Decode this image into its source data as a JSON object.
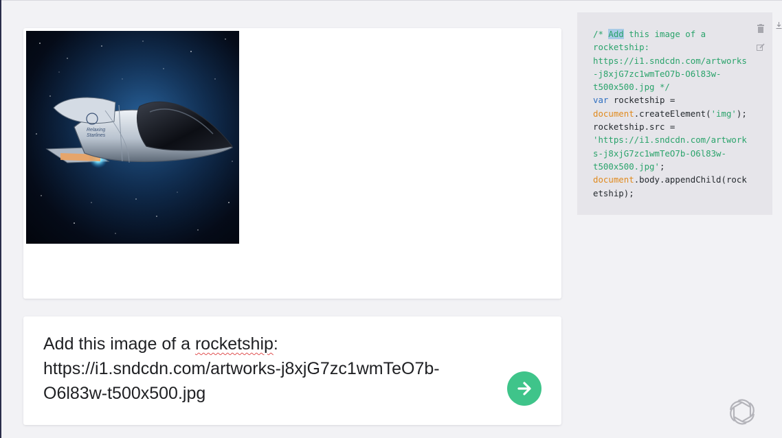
{
  "output": {
    "image_alt": "rocketship",
    "rocket_decal": [
      "Relaxing",
      "Starlines"
    ]
  },
  "prompt": {
    "line1_before": "Add this image of a ",
    "line1_word": "rocketship",
    "line1_after": ":",
    "line2": "https://i1.sndcdn.com/artworks-j8xjG7zc1wmTeO7b-",
    "line3": "O6l83w-t500x500.jpg"
  },
  "code": {
    "l1_a": "/* ",
    "l1_sel": "Add",
    "l1_b": " this image of a",
    "l2": "rocketship:",
    "l3": "https://i1.sndcdn.com/artworks",
    "l4": "-j8xjG7zc1wmTeO7b-O6l83w-",
    "l5": "t500x500.jpg */",
    "l6_kw": "var",
    "l6_rest": " rocketship =",
    "l7_obj": "document",
    "l7_mid": ".createElement(",
    "l7_str": "'img'",
    "l7_end": ");",
    "l8": "rocketship.src =",
    "l9": "'https://i1.sndcdn.com/artwork",
    "l10": "s-j8xjG7zc1wmTeO7b-O6l83w-",
    "l11_str": "t500x500.jpg'",
    "l11_end": ";",
    "l12_obj": "document",
    "l12_rest": ".body.appendChild(rock",
    "l13": "etship);"
  },
  "icons": {
    "submit": "arrow-right-icon",
    "trash": "trash-icon",
    "edit": "edit-icon",
    "download": "download-icon",
    "logo": "openai-logo"
  },
  "colors": {
    "accent": "#3fc48a",
    "comment": "#2aa36b",
    "keyword": "#2f6fc0",
    "object": "#e08a1e"
  }
}
